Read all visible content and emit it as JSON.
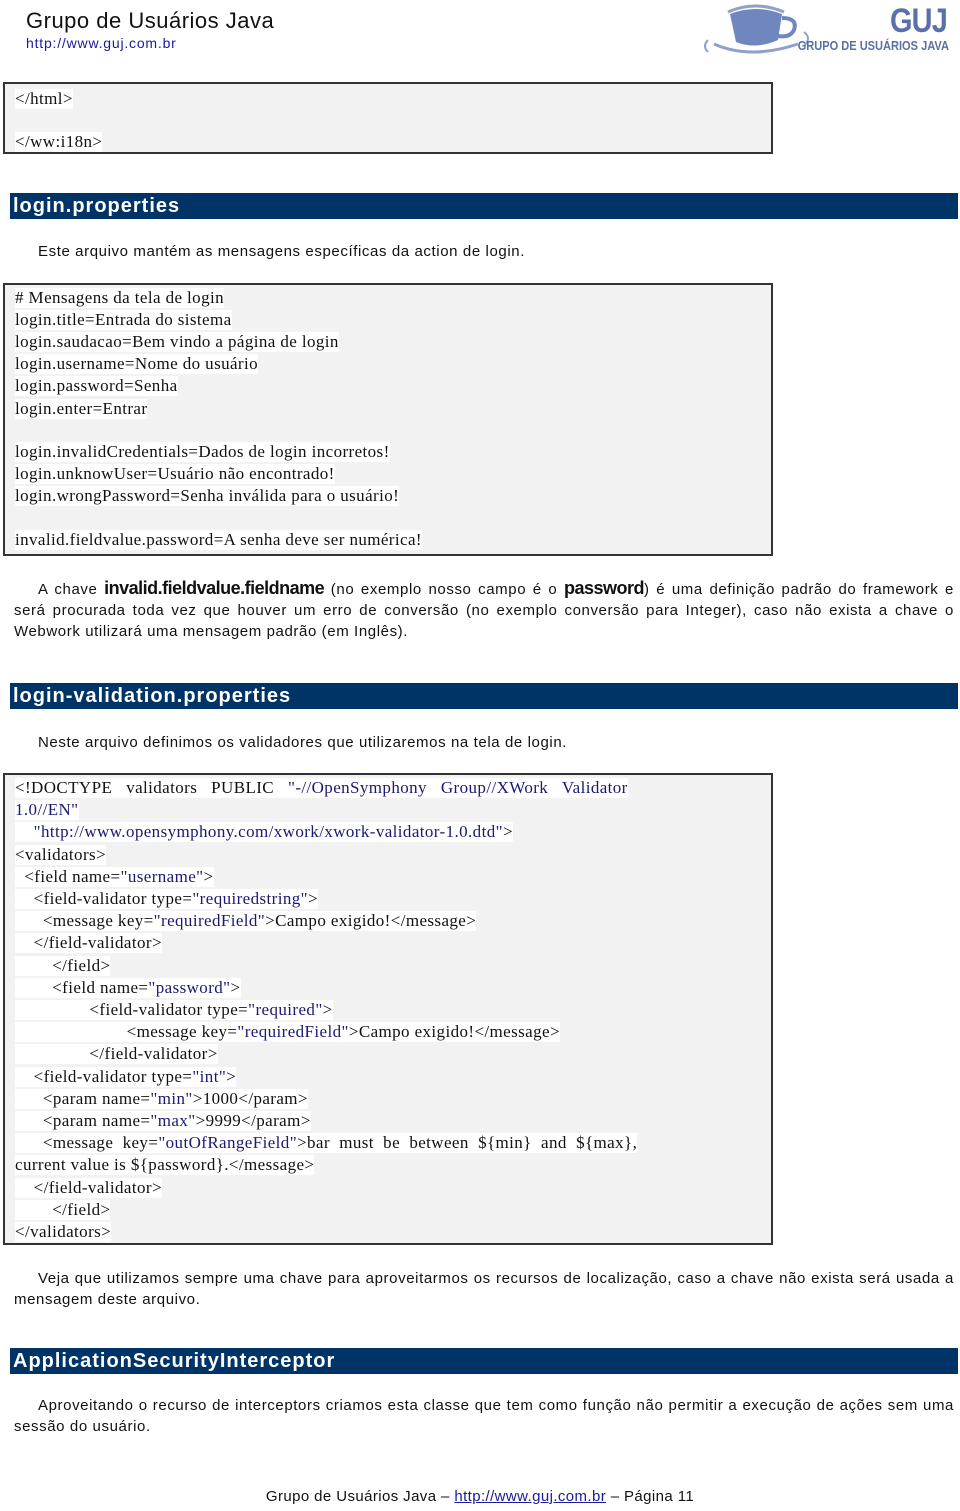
{
  "header": {
    "title": "Grupo de Usuários Java",
    "url": "http://www.guj.com.br",
    "logo": {
      "icon": "coffee-cup-icon",
      "mark": "GUJ",
      "subtitle": "GRUPO DE USUÁRIOS JAVA"
    }
  },
  "code_block_1": {
    "lines": [
      "</html>",
      "</ww:i18n>"
    ]
  },
  "section_login": {
    "title": "login.properties",
    "intro": "Este arquivo mantém as mensagens específicas da action de login.",
    "code_lines": [
      "# Mensagens da tela de login",
      "login.title=Entrada do sistema",
      "login.saudacao=Bem vindo a página de login",
      "login.username=Nome do usuário",
      "login.password=Senha",
      "login.enter=Entrar",
      "",
      "login.invalidCredentials=Dados de login incorretos!",
      "login.unknowUser=Usuário não encontrado!",
      "login.wrongPassword=Senha inválida para o usuário!",
      "",
      "invalid.fieldvalue.password=A senha deve ser numérica!"
    ],
    "explanation": {
      "part1": "A chave ",
      "key1": "invalid.fieldvalue.fieldname",
      "part2": " (no exemplo nosso campo é o ",
      "key2": "password",
      "part3": ") é uma definição padrão do framework e será procurada toda vez que houver um erro de conversão (no exemplo conversão para Integer), caso não exista a chave o Webwork utilizará uma mensagem padrão (em Inglês)."
    }
  },
  "section_validation": {
    "title": "login-validation.properties",
    "intro": "Neste arquivo definimos os validadores que utilizaremos na tela de login.",
    "code_lines": [
      {
        "pre": "<!DOCTYPE   validators   PUBLIC   ",
        "str": "\"-//OpenSymphony   Group//XWork   Validator",
        "post": ""
      },
      {
        "pre": "",
        "str": "1.0//EN\"",
        "post": ""
      },
      {
        "pre": "    ",
        "str": "\"http://www.opensymphony.com/xwork/xwork-validator-1.0.dtd\"",
        "post": ">"
      },
      {
        "pre": "<validators>",
        "str": "",
        "post": ""
      },
      {
        "pre": "  <field name=",
        "str": "\"username\"",
        "post": ">"
      },
      {
        "pre": "    <field-validator type=",
        "str": "\"requiredstring\"",
        "post": ">"
      },
      {
        "pre": "      <message key=",
        "str": "\"requiredField\"",
        "post": ">Campo exigido!</message>"
      },
      {
        "pre": "    </field-validator>",
        "str": "",
        "post": ""
      },
      {
        "pre": "        </field>",
        "str": "",
        "post": ""
      },
      {
        "pre": "        <field name=",
        "str": "\"password\"",
        "post": ">"
      },
      {
        "pre": "                <field-validator type=",
        "str": "\"required\"",
        "post": ">"
      },
      {
        "pre": "                        <message key=",
        "str": "\"requiredField\"",
        "post": ">Campo exigido!</message>"
      },
      {
        "pre": "                </field-validator>",
        "str": "",
        "post": ""
      },
      {
        "pre": "    <field-validator type=",
        "str": "\"int\"",
        "post": ">"
      },
      {
        "pre": "      <param name=",
        "str": "\"min\"",
        "post": ">1000</param>"
      },
      {
        "pre": "      <param name=",
        "str": "\"max\"",
        "post": ">9999</param>"
      },
      {
        "pre": "      <message  key=",
        "str": "\"outOfRangeField\"",
        "post": ">bar  must  be  between  ${min}  and  ${max},"
      },
      {
        "pre": "current value is ${password}.</message>",
        "str": "",
        "post": ""
      },
      {
        "pre": "    </field-validator>",
        "str": "",
        "post": ""
      },
      {
        "pre": "        </field>",
        "str": "",
        "post": ""
      },
      {
        "pre": "</validators>",
        "str": "",
        "post": ""
      }
    ],
    "note": "Veja que utilizamos sempre uma chave para aproveitarmos os recursos de localização, caso a chave não exista será usada a mensagem deste arquivo."
  },
  "section_interceptor": {
    "title": "ApplicationSecurityInterceptor",
    "intro": "Aproveitando o recurso de interceptors criamos esta classe que tem como função não permitir a execução de ações sem uma sessão do usuário."
  },
  "footer": {
    "prefix": "Grupo de Usuários Java – ",
    "url": "http://www.guj.com.br",
    "suffix": " – Página 11"
  },
  "colors": {
    "section_bar": "#003366",
    "code_bg": "#f2f2f2",
    "link": "#1a1a9a",
    "logo": "#5a70a8"
  }
}
